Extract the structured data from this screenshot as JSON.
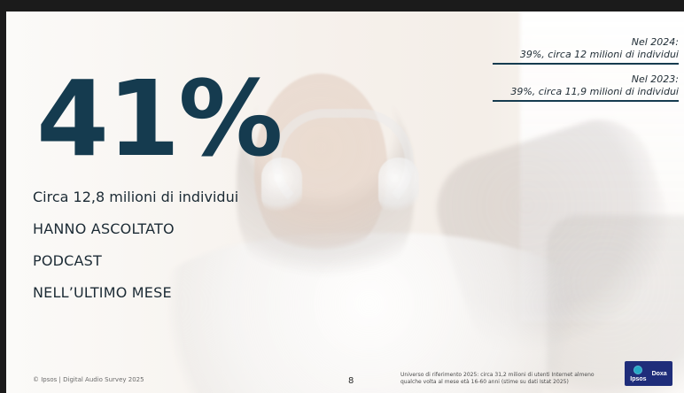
{
  "slide": {
    "big_percent": "41%",
    "main_lines": [
      "Circa 12,8 milioni di individui",
      "HANNO ASCOLTATO",
      "PODCAST",
      "NELL’ULTIMO MESE"
    ],
    "year_compare": [
      {
        "title": "Nel 2024:",
        "value": "39%, circa 12 milioni di individui"
      },
      {
        "title": "Nel 2023:",
        "value": "39%, circa 11,9 milioni di individui"
      }
    ],
    "footer": {
      "left": "© Ipsos | Digital Audio Survey 2025",
      "page": "8",
      "note": "Universo di riferimento 2025: circa 31,2 milioni di utenti Internet almeno qualche volta al mese età 16-60 anni (stime su dati Istat 2025)"
    },
    "logo": {
      "left": "Ipsos",
      "right": "Doxa"
    }
  },
  "colors": {
    "primary_dark": "#153b4f",
    "logo_bg": "#1f2d7a",
    "logo_accent": "#26a9c6"
  }
}
